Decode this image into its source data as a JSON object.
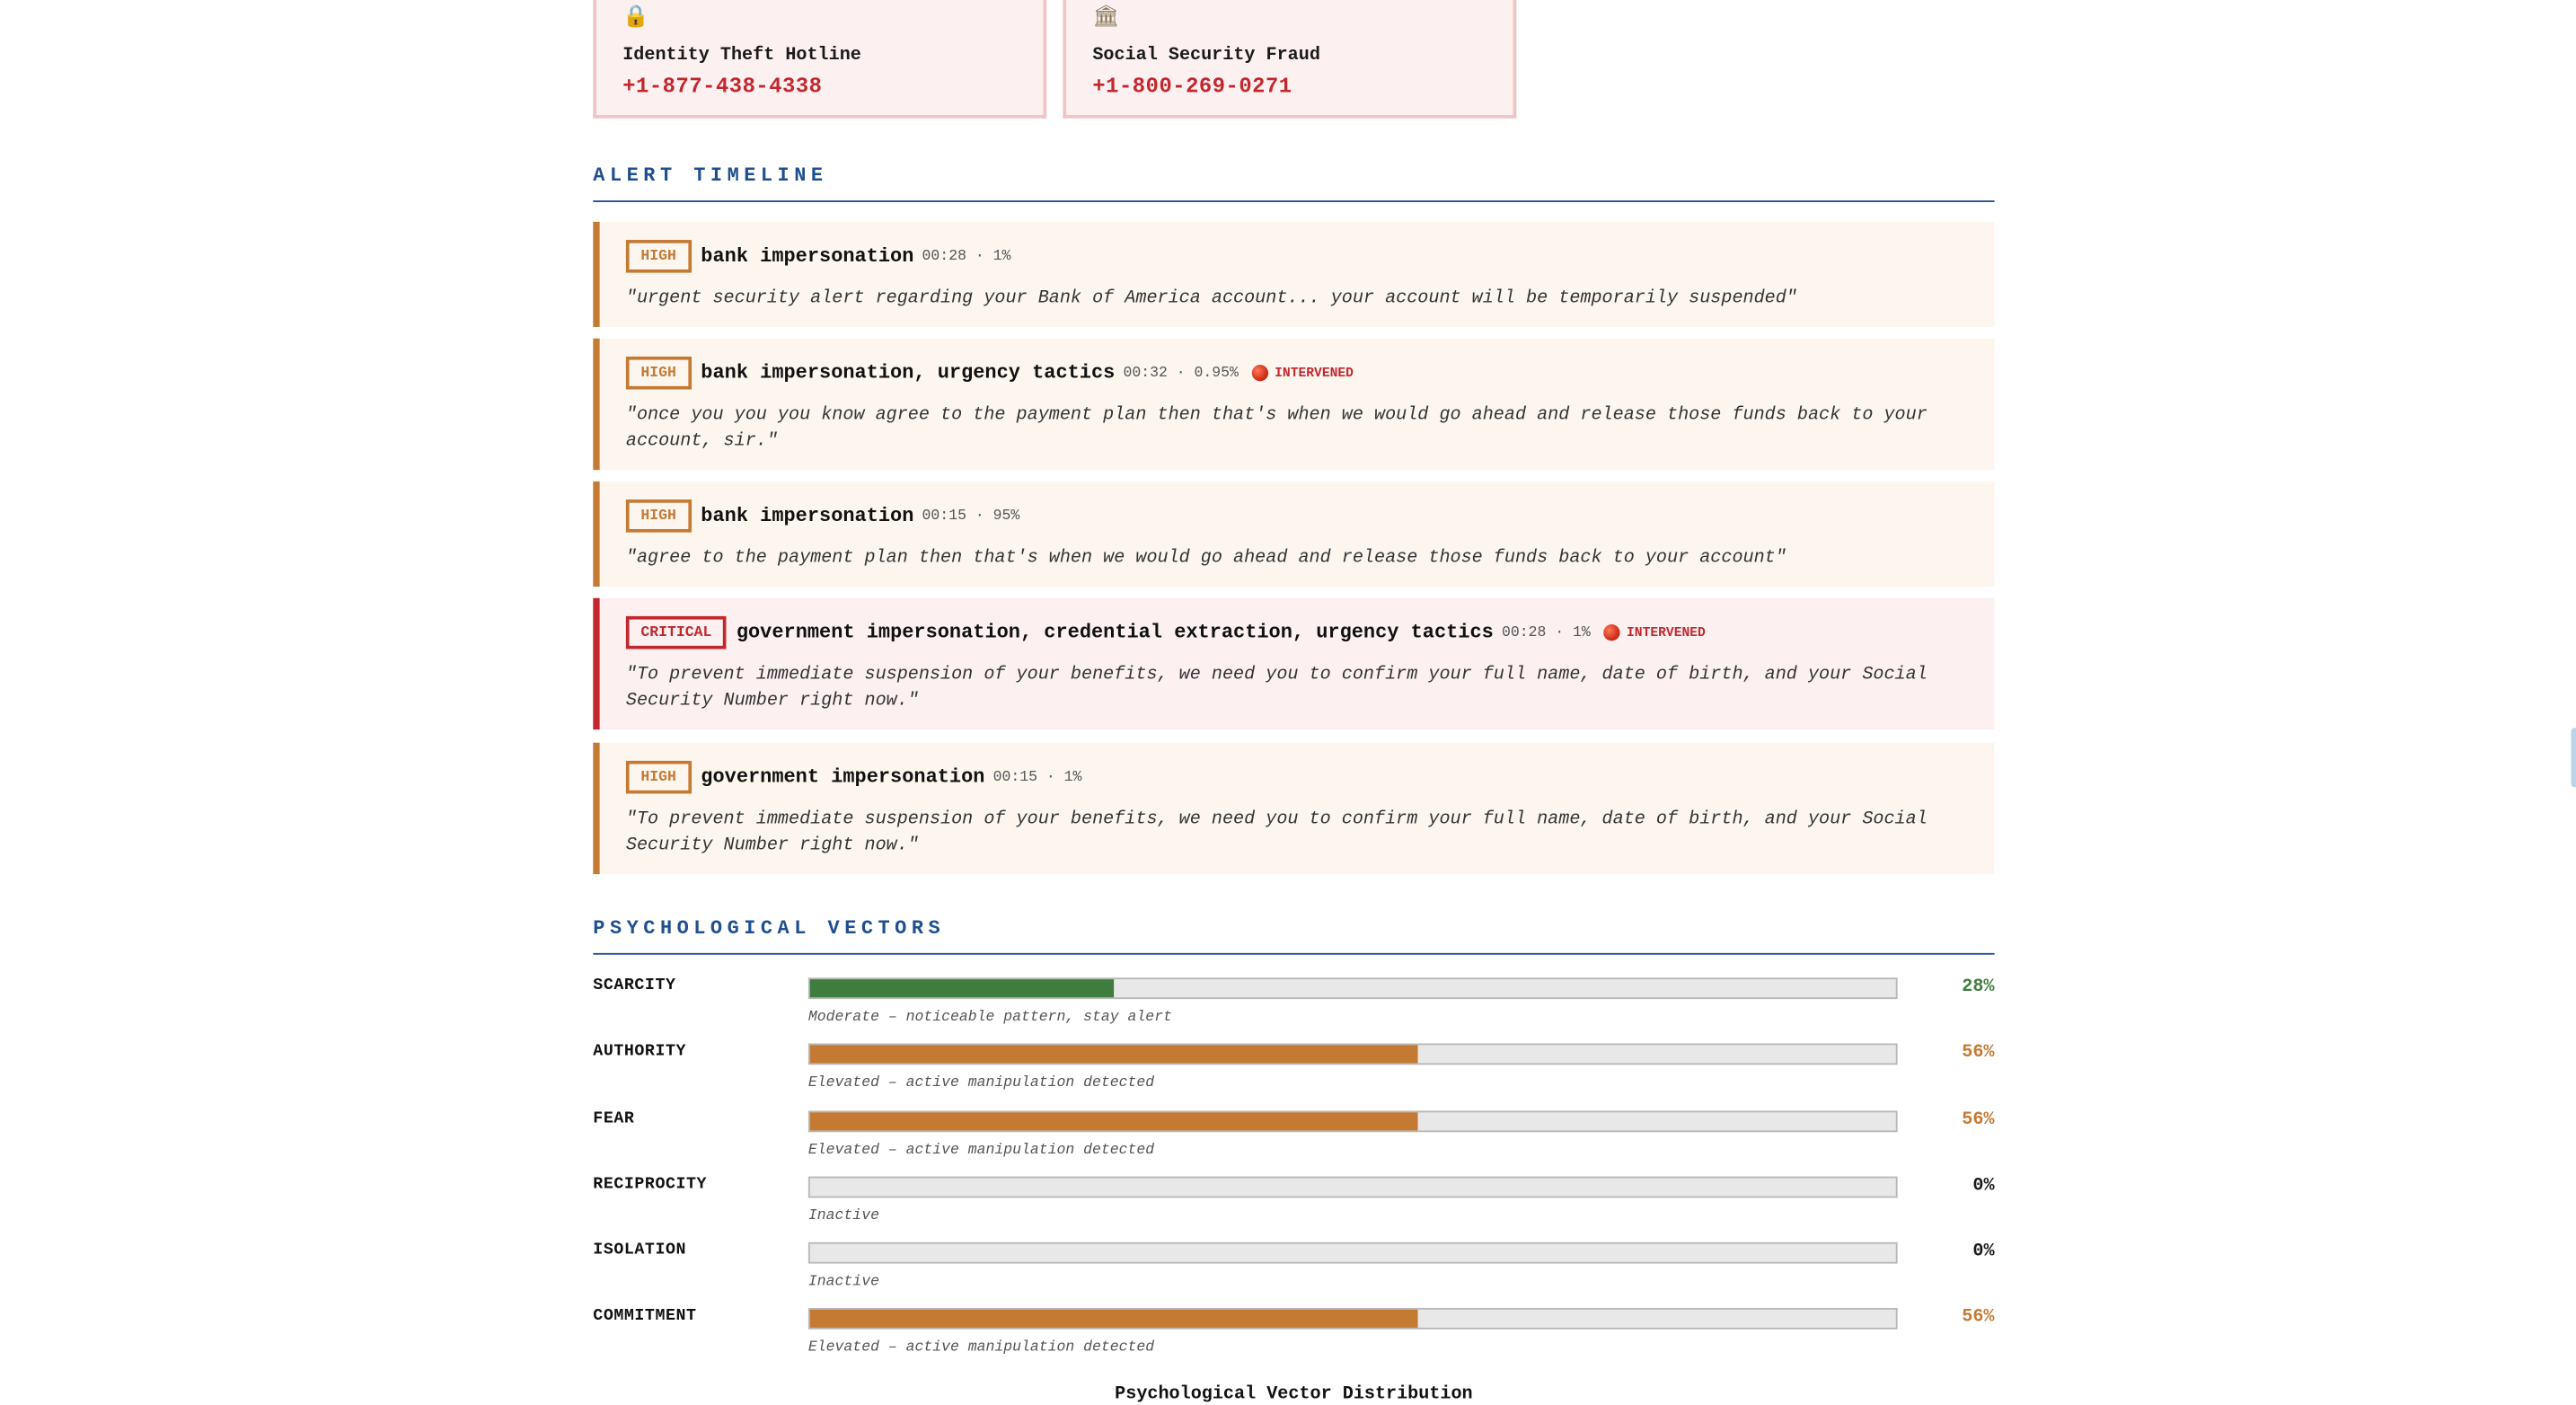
{
  "hotlines": [
    {
      "icon": "lock-icon",
      "glyph": "🔒",
      "label": "Identity Theft Hotline",
      "phone": "+1-877-438-4338"
    },
    {
      "icon": "bank-icon",
      "glyph": "🏛",
      "label": "Social Security Fraud",
      "phone": "+1-800-269-0271"
    }
  ],
  "timeline": {
    "title": "ALERT TIMELINE",
    "alerts": [
      {
        "severity": "HIGH",
        "title": "bank impersonation",
        "meta": "00:28 · 1%",
        "intervened": "",
        "quote": "\"urgent security alert regarding your Bank of America account... your account will be temporarily suspended\""
      },
      {
        "severity": "HIGH",
        "title": "bank impersonation, urgency tactics",
        "meta": "00:32 · 0.95%",
        "intervened": "INTERVENED",
        "quote": "\"once you you you know agree to the payment plan then that's when we would go ahead and release those funds back to your account, sir.\""
      },
      {
        "severity": "HIGH",
        "title": "bank impersonation",
        "meta": "00:15 · 95%",
        "intervened": "",
        "quote": "\"agree to the payment plan then that's when we would go ahead and release those funds back to your account\""
      },
      {
        "severity": "CRITICAL",
        "title": "government impersonation, credential extraction, urgency tactics",
        "meta": "00:28 · 1%",
        "intervened": "INTERVENED",
        "quote": "\"To prevent immediate suspension of your benefits, we need you to confirm your full name, date of birth, and your Social Security Number right now.\""
      },
      {
        "severity": "HIGH",
        "title": "government impersonation",
        "meta": "00:15 · 1%",
        "intervened": "",
        "quote": "\"To prevent immediate suspension of your benefits, we need you to confirm your full name, date of birth, and your Social Security Number right now.\""
      }
    ]
  },
  "vectors": {
    "title": "PSYCHOLOGICAL VECTORS",
    "items": [
      {
        "name": "SCARCITY",
        "percent": 28,
        "label": "28%",
        "desc": "Moderate – noticeable pattern, stay alert",
        "color": "#3e7d3e"
      },
      {
        "name": "AUTHORITY",
        "percent": 56,
        "label": "56%",
        "desc": "Elevated – active manipulation detected",
        "color": "#c47a33"
      },
      {
        "name": "FEAR",
        "percent": 56,
        "label": "56%",
        "desc": "Elevated – active manipulation detected",
        "color": "#c47a33"
      },
      {
        "name": "RECIPROCITY",
        "percent": 0,
        "label": "0%",
        "desc": "Inactive",
        "color": "#1a1a1a"
      },
      {
        "name": "ISOLATION",
        "percent": 0,
        "label": "0%",
        "desc": "Inactive",
        "color": "#1a1a1a"
      },
      {
        "name": "COMMITMENT",
        "percent": 56,
        "label": "56%",
        "desc": "Elevated – active manipulation detected",
        "color": "#c47a33"
      }
    ]
  },
  "chart_heading": "Psychological Vector Distribution"
}
